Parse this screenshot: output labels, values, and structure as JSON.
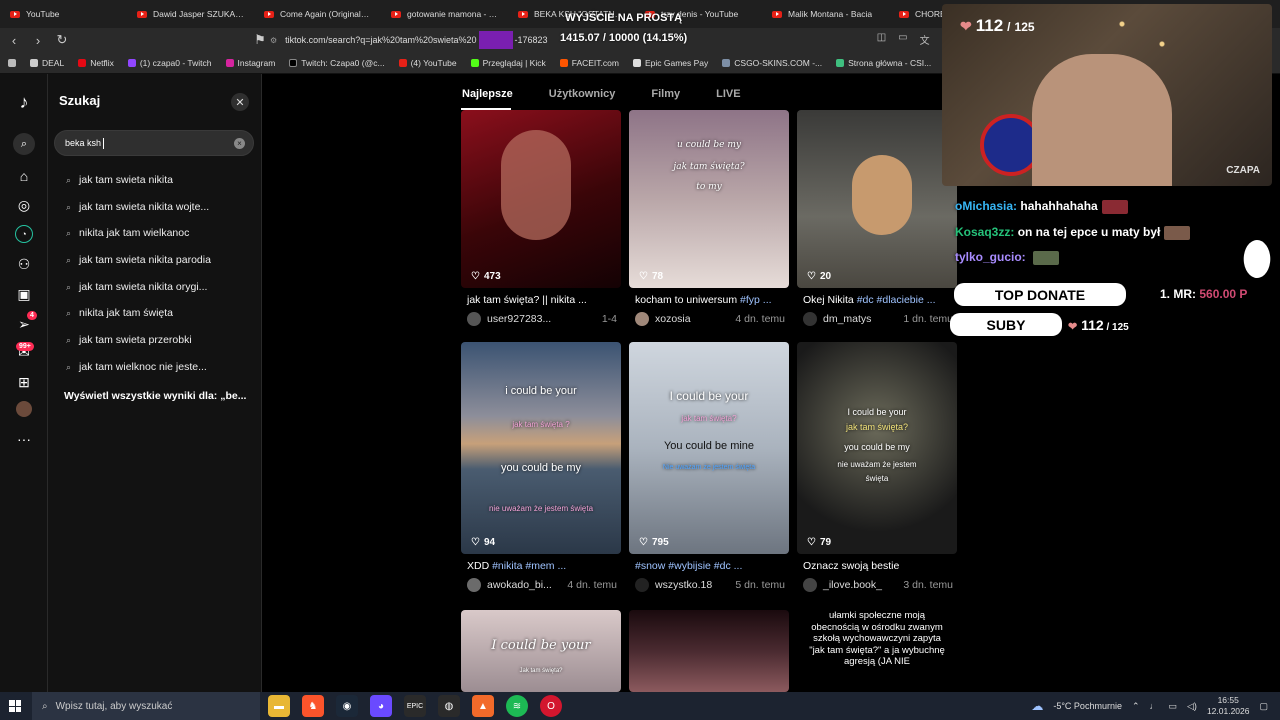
{
  "browser": {
    "tabs": [
      "YouTube",
      "Dawid Jasper SZUKANIE M",
      "Come Again (Original Rad",
      "gotowanie mamona - You",
      "BEKA KSH \"OSTATNI RAZ",
      "trzy denis - YouTube",
      "Malik Montana - Bacia",
      "CHORE U"
    ],
    "url_prefix": "tiktok.com/search?q=jak%20tam%20swieta%20",
    "url_suffix": "-176823",
    "bookmarks": [
      "DEAL",
      "Netflix",
      "(1) czapa0 - Twitch",
      "Instagram",
      "Twitch: Czapa0 (@c...",
      "(4) YouTube",
      "Przeglądaj | Kick",
      "FACEIT.com",
      "Epic Games Pay",
      "CSGO-SKINS.COM -...",
      "Strona główna - CSI..."
    ]
  },
  "tiktok": {
    "sidebar_badges": {
      "inbox": "4",
      "activity": "99+"
    },
    "search": {
      "title": "Szukaj",
      "query": "beka ksh",
      "suggestions": [
        "jak tam swieta nikita",
        "jak tam swieta nikita wojte...",
        "nikita jak tam wielkanoc",
        "jak tam swieta nikita parodia",
        "jak tam swieta nikita orygi...",
        "nikita jak tam święta",
        "jak tam swieta przerobki",
        "jak tam wielknoc nie jeste..."
      ],
      "show_all": "Wyświetl wszystkie wyniki dla: „be..."
    },
    "tabs": [
      "Najlepsze",
      "Użytkownicy",
      "Filmy",
      "LIVE"
    ],
    "videos": [
      {
        "likes": "473",
        "caption": "jak tam święta? || nikita ...",
        "tags": "",
        "user": "user927283...",
        "date": "1-4",
        "overlay": []
      },
      {
        "likes": "78",
        "caption": "kocham to uniwersum ",
        "tags": "#fyp ...",
        "user": "xozosia",
        "date": "4 dn. temu",
        "overlay": [
          "u could be my",
          "jak tam święta?",
          "to my"
        ]
      },
      {
        "likes": "20",
        "caption": "Okej Nikita ",
        "tags": "#dc #dlaciebie ...",
        "user": "dm_matys",
        "date": "1 dn. temu",
        "overlay": []
      },
      {
        "likes": "94",
        "caption": "XDD ",
        "tags": "#nikita #mem ...",
        "user": "awokado_bi...",
        "date": "4 dn. temu",
        "overlay": [
          "i could be your",
          "jak tam święta ?",
          "you could be my",
          "nie uważam że jestem święta"
        ]
      },
      {
        "likes": "795",
        "caption": "",
        "tags": "#snow #wybijsie #dc ...",
        "user": "wszystko.18",
        "date": "5 dn. temu",
        "overlay": [
          "I could be your",
          "jak tam święta?",
          "You could be mine",
          "Nie uważam że jestem święta"
        ]
      },
      {
        "likes": "79",
        "caption": "Oznacz swoją bestie ",
        "tags": "",
        "user": "_ilove.book_",
        "date": "3 dn. temu",
        "overlay": [
          "I could be your",
          "jak tam święta?",
          "you could be my",
          "nie uważam że jestem",
          "święta"
        ]
      }
    ],
    "row3": {
      "first_overlay": "I could be your",
      "first_sub": "Jak tam święta?",
      "third_text": "ułamki społeczne moją obecnością w ośrodku zwanym szkołą wychowawczyni zapyta \"jak tam święta?\" a ja wybuchnę agresją (JA NIE"
    }
  },
  "stream": {
    "sub_count": "112",
    "sub_goal": "125",
    "goal_title": "WYJŚCIE NA PROSTĄ",
    "goal_progress": "1415.07 / 10000 (14.15%)",
    "streamer_label": "CZAPA",
    "chat": [
      {
        "user": "oMichasia:",
        "msg": "hahahhahaha"
      },
      {
        "user": "Kosaq3zz:",
        "msg": "on na tej epce u maty był"
      },
      {
        "user": "tylko_gucio:",
        "msg": ""
      }
    ],
    "top_donate_label": "TOP DONATE",
    "top_donate_prefix": "1. MR:",
    "top_donate_amount": "560.00 P",
    "subs_label": "SUBY"
  },
  "taskbar": {
    "search_placeholder": "Wpisz tutaj, aby wyszukać",
    "weather": "-5°C  Pochmurnie",
    "time": "16:55",
    "date": "12.01.2026"
  }
}
